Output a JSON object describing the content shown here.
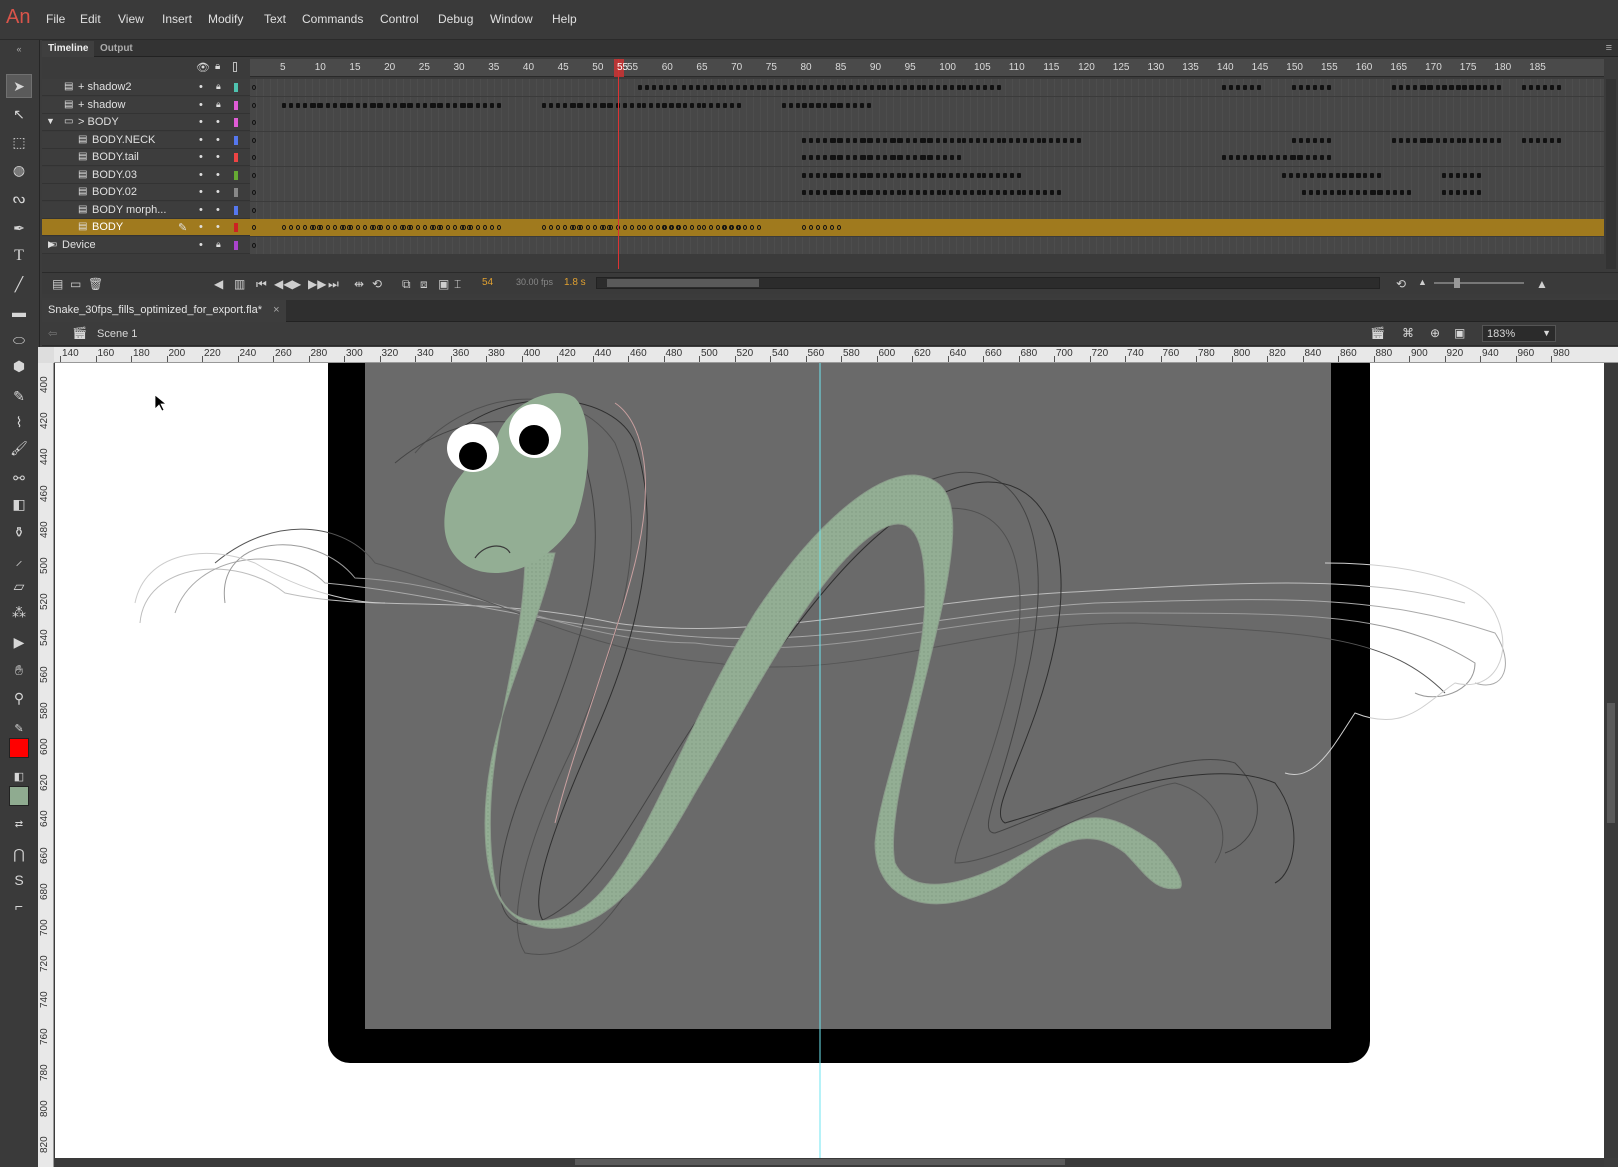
{
  "app": {
    "logo": "An"
  },
  "menu": [
    "File",
    "Edit",
    "View",
    "Insert",
    "Modify",
    "Text",
    "Commands",
    "Control",
    "Debug",
    "Window",
    "Help"
  ],
  "timeline": {
    "tabs": [
      "Timeline",
      "Output"
    ],
    "frame_numbers": [
      "5",
      "10",
      "15",
      "20",
      "25",
      "30",
      "35",
      "40",
      "45",
      "50",
      "55",
      "60",
      "65",
      "70",
      "75",
      "80",
      "85",
      "90",
      "95",
      "100",
      "105",
      "110",
      "115",
      "120",
      "125",
      "130",
      "135",
      "140",
      "145",
      "150",
      "155",
      "160",
      "165",
      "170",
      "175",
      "180",
      "185"
    ],
    "playhead_frame": "55",
    "layers": [
      {
        "name": "+ shadow2",
        "swatch": "#4fc3b0",
        "locked": true
      },
      {
        "name": "+ shadow",
        "swatch": "#e05cd6",
        "locked": true
      },
      {
        "name": "> BODY",
        "swatch": "#e05cd6",
        "locked": false
      },
      {
        "name": "BODY.NECK",
        "swatch": "#5577ee",
        "locked": false
      },
      {
        "name": "BODY.tail",
        "swatch": "#ee4444",
        "locked": false
      },
      {
        "name": "BODY.03",
        "swatch": "#66aa33",
        "locked": false
      },
      {
        "name": "BODY.02",
        "swatch": "#888888",
        "locked": false
      },
      {
        "name": "BODY morph...",
        "swatch": "#5577ee",
        "locked": false
      },
      {
        "name": "BODY",
        "swatch": "#cc2222",
        "locked": false
      },
      {
        "name": "Device",
        "swatch": "#aa44cc",
        "locked": true
      }
    ],
    "footer": {
      "current_frame": "54",
      "fps": "30.00 fps",
      "elapsed": "1.8 s"
    }
  },
  "document": {
    "tab_title": "Snake_30fps_fills_optimized_for_export.fla*",
    "close_glyph": "×",
    "scene": "Scene 1",
    "zoom": "183%"
  },
  "rulers": {
    "horizontal": [
      "140",
      "160",
      "180",
      "200",
      "220",
      "240",
      "260",
      "280",
      "300",
      "320",
      "340",
      "360",
      "380",
      "400",
      "420",
      "440",
      "460",
      "480",
      "500",
      "520",
      "540",
      "560",
      "580",
      "600",
      "620",
      "640",
      "660",
      "680",
      "700",
      "720",
      "740",
      "760",
      "780",
      "800",
      "820",
      "840",
      "860",
      "880",
      "900",
      "920",
      "940",
      "960",
      "980"
    ],
    "vertical": [
      "400",
      "420",
      "440",
      "460",
      "480",
      "500",
      "520",
      "540",
      "560",
      "580",
      "600",
      "620",
      "640",
      "660",
      "680",
      "700",
      "720",
      "740",
      "760",
      "780",
      "800",
      "820"
    ]
  },
  "colors": {
    "stroke": "#ff0000",
    "fill": "#8fab90",
    "stage_bg": "#6a6a6a",
    "snake": "#93ae94",
    "selected_layer": "#a07a1e"
  },
  "icons": [
    "selection-tool-icon",
    "subselection-tool-icon",
    "free-transform-icon",
    "3d-rotation-icon",
    "lasso-icon",
    "pen-icon",
    "text-icon",
    "line-icon",
    "rectangle-icon",
    "oval-icon",
    "polystar-icon",
    "pencil-icon",
    "paint-brush-icon",
    "brush-icon",
    "bone-icon",
    "paint-bucket-icon",
    "ink-bottle-icon",
    "eyedropper-icon",
    "eraser-icon",
    "width-tool-icon",
    "camera-icon",
    "hand-icon",
    "zoom-icon"
  ]
}
